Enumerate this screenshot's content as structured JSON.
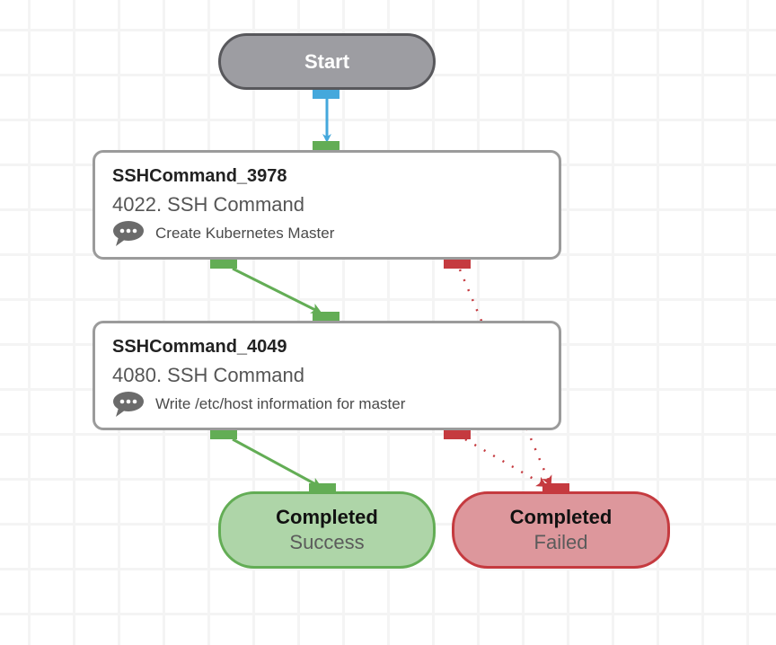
{
  "colors": {
    "flow_start": "#45a8dc",
    "flow_success": "#63ad55",
    "flow_failure": "#c53a3f",
    "task_border": "#9b9b9b",
    "start_fill": "#9d9da2"
  },
  "nodes": {
    "start": {
      "label": "Start"
    },
    "tasks": [
      {
        "id": "SSHCommand_3978",
        "title": "SSHCommand_3978",
        "subtitle": "4022. SSH Command",
        "comment_icon": "speech-bubble-icon",
        "comment": "Create Kubernetes Master"
      },
      {
        "id": "SSHCommand_4049",
        "title": "SSHCommand_4049",
        "subtitle": "4080. SSH Command",
        "comment_icon": "speech-bubble-icon",
        "comment": "Write /etc/host information for master"
      }
    ],
    "end_success": {
      "title": "Completed",
      "status": "Success"
    },
    "end_failed": {
      "title": "Completed",
      "status": "Failed"
    }
  },
  "edges": [
    {
      "from": "Start",
      "to": "SSHCommand_3978",
      "type": "start",
      "style": "solid"
    },
    {
      "from": "SSHCommand_3978",
      "to": "SSHCommand_4049",
      "type": "success",
      "style": "solid"
    },
    {
      "from": "SSHCommand_3978",
      "to": "Completed Failed",
      "type": "failure",
      "style": "dotted"
    },
    {
      "from": "SSHCommand_4049",
      "to": "Completed Success",
      "type": "success",
      "style": "solid"
    },
    {
      "from": "SSHCommand_4049",
      "to": "Completed Failed",
      "type": "failure",
      "style": "dotted"
    }
  ]
}
